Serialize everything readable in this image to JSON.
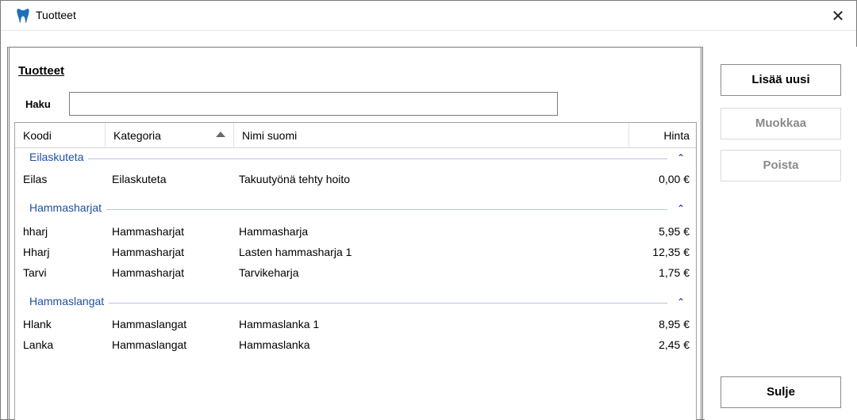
{
  "window": {
    "title": "Tuotteet",
    "close_glyph": "✕"
  },
  "main": {
    "section_title": "Tuotteet",
    "search_label": "Haku",
    "search_value": ""
  },
  "grid": {
    "columns": [
      "Koodi",
      "Kategoria",
      "Nimi suomi",
      "Hinta"
    ],
    "sort_column": "Kategoria",
    "sort_direction": "ascending",
    "groups": [
      {
        "name": "Eilaskuteta",
        "rows": [
          {
            "code": "Eilas",
            "category": "Eilaskuteta",
            "name": "Takuutyönä tehty hoito",
            "price": "0,00 €"
          }
        ]
      },
      {
        "name": "Hammasharjat",
        "rows": [
          {
            "code": "hharj",
            "category": "Hammasharjat",
            "name": "Hammasharja",
            "price": "5,95 €"
          },
          {
            "code": "Hharj",
            "category": "Hammasharjat",
            "name": "Lasten hammasharja 1",
            "price": "12,35 €"
          },
          {
            "code": "Tarvi",
            "category": "Hammasharjat",
            "name": "Tarvikeharja",
            "price": "1,75 €"
          }
        ]
      },
      {
        "name": "Hammaslangat",
        "rows": [
          {
            "code": "Hlank",
            "category": "Hammaslangat",
            "name": "Hammaslanka 1",
            "price": "8,95 €"
          },
          {
            "code": "Lanka",
            "category": "Hammaslangat",
            "name": "Hammaslanka",
            "price": "2,45 €"
          }
        ]
      }
    ]
  },
  "buttons": {
    "add": "Lisää uusi",
    "edit": "Muokkaa",
    "delete": "Poista",
    "close": "Sulje"
  },
  "icons": {
    "app": "tooth-icon",
    "sort": "sort-ascending-icon",
    "collapse": "chevron-up-icon"
  },
  "colors": {
    "group_text": "#1f4f9e",
    "group_line": "#b8c4de",
    "app_icon": "#1f6fb8"
  }
}
